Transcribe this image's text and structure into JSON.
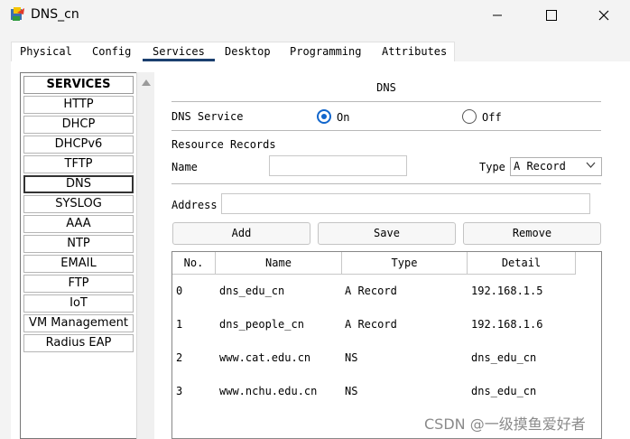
{
  "window": {
    "title": "DNS_cn",
    "icons": [
      "packet-tracer-app-icon",
      "minimize-icon",
      "maximize-icon",
      "close-icon"
    ]
  },
  "tabs": [
    {
      "label": "Physical"
    },
    {
      "label": "Config"
    },
    {
      "label": "Services",
      "active": true
    },
    {
      "label": "Desktop"
    },
    {
      "label": "Programming"
    },
    {
      "label": "Attributes"
    }
  ],
  "services": {
    "header": "SERVICES",
    "items": [
      "HTTP",
      "DHCP",
      "DHCPv6",
      "TFTP",
      "DNS",
      "SYSLOG",
      "AAA",
      "NTP",
      "EMAIL",
      "FTP",
      "IoT",
      "VM Management",
      "Radius EAP"
    ],
    "selected": "DNS"
  },
  "dns": {
    "title": "DNS",
    "service_label": "DNS Service",
    "on_label": "On",
    "off_label": "Off",
    "service_state": "On",
    "resource_records_label": "Resource Records",
    "name_label": "Name",
    "name_value": "",
    "type_label": "Type",
    "type_value": "A Record",
    "address_label": "Address",
    "address_value": "",
    "buttons": {
      "add": "Add",
      "save": "Save",
      "remove": "Remove"
    },
    "table": {
      "headers": [
        "No.",
        "Name",
        "Type",
        "Detail"
      ],
      "rows": [
        {
          "no": "0",
          "name": "dns_edu_cn",
          "type": "A Record",
          "detail": "192.168.1.5"
        },
        {
          "no": "1",
          "name": "dns_people_cn",
          "type": "A Record",
          "detail": "192.168.1.6"
        },
        {
          "no": "2",
          "name": "www.cat.edu.cn",
          "type": "NS",
          "detail": "dns_edu_cn"
        },
        {
          "no": "3",
          "name": "www.nchu.edu.cn",
          "type": "NS",
          "detail": "dns_edu_cn"
        }
      ]
    }
  },
  "watermark": "CSDN @一级摸鱼爱好者",
  "colors": {
    "accent": "#1166cc",
    "tab_underline": "#1a3f6f"
  }
}
